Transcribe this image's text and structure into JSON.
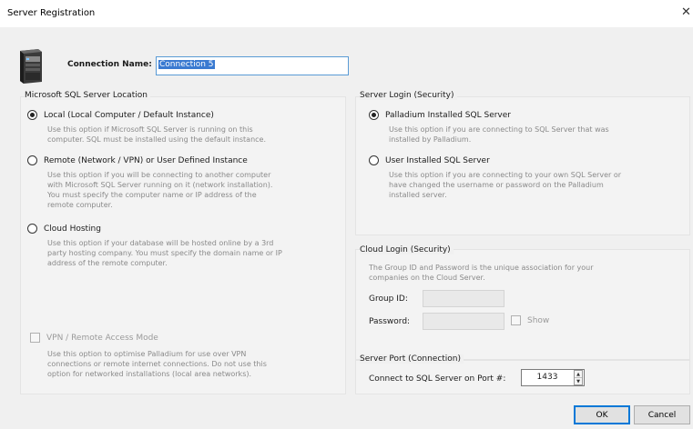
{
  "window": {
    "title": "Server Registration",
    "close_glyph": "✕"
  },
  "connection": {
    "label": "Connection Name:",
    "value": "Connection 5"
  },
  "sql_location": {
    "title": "Microsoft SQL Server Location",
    "options": [
      {
        "label": "Local (Local Computer / Default Instance)",
        "checked": true,
        "desc": [
          "Use this option if Microsoft SQL Server is running on this",
          "computer. SQL must be installed using the default instance."
        ]
      },
      {
        "label": "Remote (Network / VPN) or User Defined Instance",
        "checked": false,
        "desc": [
          "Use this option if you will be connecting to another computer",
          "with Microsoft SQL Server running on it (network installation).",
          "You must specify the computer name or IP address of the",
          "remote computer."
        ]
      },
      {
        "label": "Cloud Hosting",
        "checked": false,
        "desc": [
          "Use this option if your database will be hosted online by a 3rd",
          "party hosting company. You must specify the domain name or IP",
          "address of the remote computer."
        ]
      }
    ],
    "vpn": {
      "label": "VPN / Remote Access Mode",
      "checked": false,
      "desc": [
        "Use this option to optimise Palladium for use over VPN",
        "connections or remote internet connections. Do not use this",
        "option for networked installations (local area networks)."
      ]
    }
  },
  "server_login": {
    "title": "Server Login (Security)",
    "options": [
      {
        "label": "Palladium Installed SQL Server",
        "checked": true,
        "desc": [
          "Use this option if you are connecting to SQL Server that was",
          "installed by Palladium."
        ]
      },
      {
        "label": "User Installed SQL Server",
        "checked": false,
        "desc": [
          "Use this option if you are connecting to your own SQL Server or",
          "have changed the username or password on the Palladium",
          "installed server."
        ]
      }
    ]
  },
  "cloud_login": {
    "title": "Cloud Login (Security)",
    "desc": [
      "The Group ID and Password is the unique association for your",
      "companies on the Cloud Server."
    ],
    "group_id_label": "Group ID:",
    "group_id_value": "",
    "password_label": "Password:",
    "password_value": "",
    "show_label": "Show"
  },
  "server_port": {
    "title": "Server Port (Connection)",
    "label": "Connect to SQL Server on Port #:",
    "value": "1433",
    "spin_up": "▲",
    "spin_down": "▼"
  },
  "buttons": {
    "ok": "OK",
    "cancel": "Cancel"
  },
  "icons": {
    "server": "server-tower-icon",
    "close": "close-icon"
  }
}
